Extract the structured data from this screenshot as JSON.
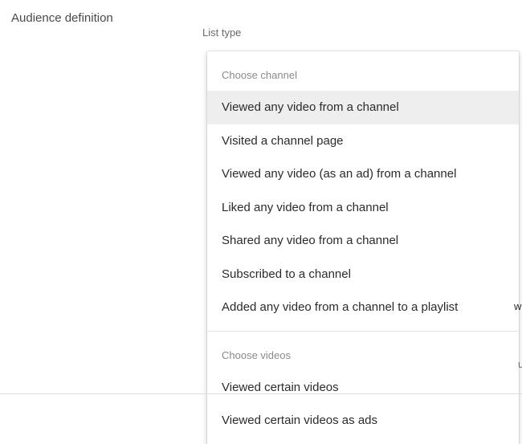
{
  "section_label": "Audience definition",
  "field_label": "List type",
  "dropdown": {
    "groups": [
      {
        "header": "Choose channel",
        "options": [
          {
            "label": "Viewed any video from a channel",
            "selected": true
          },
          {
            "label": "Visited a channel page",
            "selected": false
          },
          {
            "label": "Viewed any video (as an ad) from a channel",
            "selected": false
          },
          {
            "label": "Liked any video from a channel",
            "selected": false
          },
          {
            "label": "Shared any video from a channel",
            "selected": false
          },
          {
            "label": "Subscribed to a channel",
            "selected": false
          },
          {
            "label": "Added any video from a channel to a playlist",
            "selected": false
          }
        ]
      },
      {
        "header": "Choose videos",
        "options": [
          {
            "label": "Viewed certain videos",
            "selected": false
          },
          {
            "label": "Viewed certain videos as ads",
            "selected": false
          }
        ]
      }
    ]
  },
  "stray_text_w": "w",
  "stray_text_u": "u"
}
